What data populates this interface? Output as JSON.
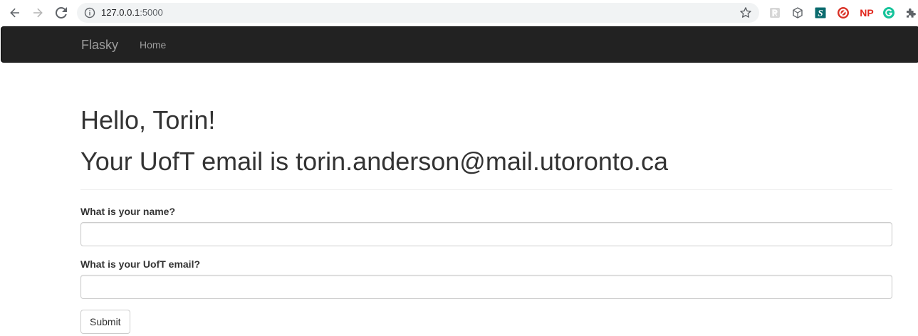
{
  "browser": {
    "url_host": "127.0.0.1",
    "url_port": ":5000",
    "extensions": [
      {
        "name": "reader-extension-icon",
        "color": "#b0b0b0",
        "glyph": "ℛ"
      },
      {
        "name": "cube-extension-icon",
        "color": "#5f6368",
        "glyph": ""
      },
      {
        "name": "s-extension-icon",
        "color": "#0b6b6e",
        "glyph": "S"
      },
      {
        "name": "block-extension-icon",
        "color": "#d93025",
        "glyph": ""
      },
      {
        "name": "np-extension-icon",
        "color": "#e1261c",
        "glyph": "NP"
      },
      {
        "name": "grammarly-extension-icon",
        "color": "#15c39a",
        "glyph": "G"
      },
      {
        "name": "puzzle-extension-icon",
        "color": "#5f6368",
        "glyph": ""
      }
    ]
  },
  "navbar": {
    "brand": "Flasky",
    "home_label": "Home",
    "background": "#222222"
  },
  "header": {
    "greeting": "Hello, Torin!",
    "email_line": "Your UofT email is torin.anderson@mail.utoronto.ca"
  },
  "form": {
    "name_label": "What is your name?",
    "name_value": "",
    "email_label": "What is your UofT email?",
    "email_value": "",
    "submit_label": "Submit"
  }
}
